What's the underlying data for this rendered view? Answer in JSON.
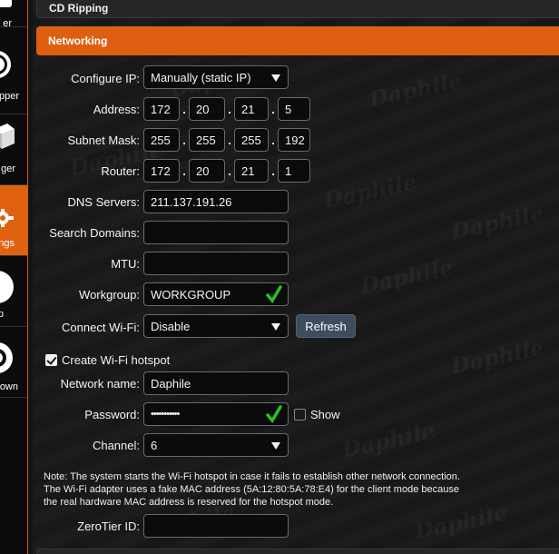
{
  "sidebar": {
    "items": [
      {
        "label": "er",
        "icon": "disc-icon"
      },
      {
        "label": "pper",
        "icon": "ripper-icon"
      },
      {
        "label": "ger",
        "icon": "box-icon"
      },
      {
        "label": "ngs",
        "icon": "gear-icon",
        "active": true
      },
      {
        "label": "p",
        "icon": "help-icon"
      },
      {
        "label": "own",
        "icon": "power-icon"
      }
    ]
  },
  "sections": {
    "cd_ripping": "CD Ripping",
    "networking": "Networking"
  },
  "watermark": "Daphile",
  "form": {
    "configure_ip": {
      "label": "Configure IP:",
      "value": "Manually (static IP)"
    },
    "address": {
      "label": "Address:",
      "octets": [
        "172",
        "20",
        "21",
        "5"
      ]
    },
    "subnet_mask": {
      "label": "Subnet Mask:",
      "octets": [
        "255",
        "255",
        "255",
        "192"
      ]
    },
    "router": {
      "label": "Router:",
      "octets": [
        "172",
        "20",
        "21",
        "1"
      ]
    },
    "dns_servers": {
      "label": "DNS Servers:",
      "value": "211.137.191.26"
    },
    "search_domains": {
      "label": "Search Domains:",
      "value": ""
    },
    "mtu": {
      "label": "MTU:",
      "value": ""
    },
    "workgroup": {
      "label": "Workgroup:",
      "value": "WORKGROUP"
    },
    "connect_wifi": {
      "label": "Connect Wi-Fi:",
      "value": "Disable",
      "refresh_label": "Refresh"
    },
    "hotspot": {
      "label": "Create Wi-Fi hotspot",
      "checked": true
    },
    "network_name": {
      "label": "Network name:",
      "value": "Daphile"
    },
    "password": {
      "label": "Password:",
      "value": "•••••••••••",
      "show_label": "Show"
    },
    "channel": {
      "label": "Channel:",
      "value": "6"
    },
    "note": "Note: The system starts the Wi-Fi hotspot in case it fails to establish other network connection. The Wi-Fi adapter uses a fake MAC address (5A:12:80:5A:78:E4) for the client mode because the real hardware MAC address is reserved for the hotspot mode.",
    "zerotier": {
      "label": "ZeroTier ID:",
      "value": ""
    }
  },
  "colors": {
    "accent": "#df5f12",
    "check": "#2bbf2b",
    "button": "#3d4d5e"
  }
}
